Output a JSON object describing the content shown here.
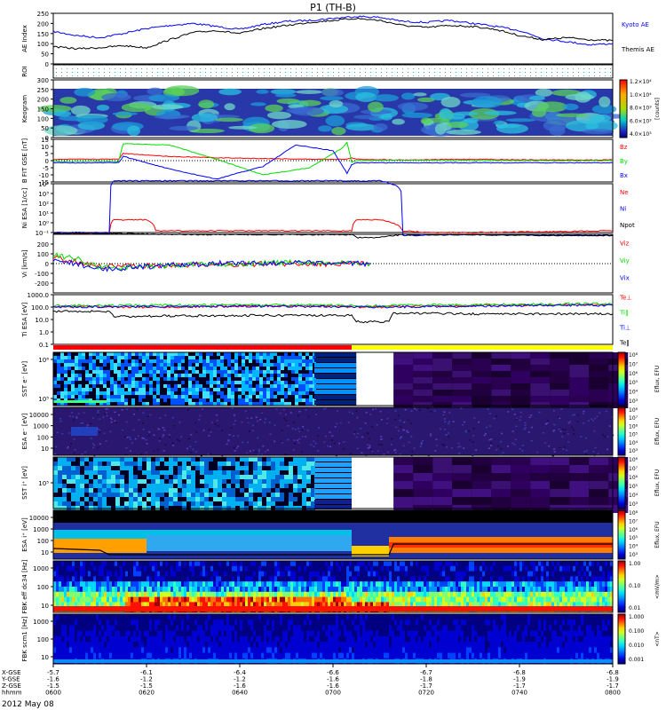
{
  "title": "P1 (TH-B)",
  "date_label": "2012 May 08",
  "colors": {
    "kyoto": "#0000ff",
    "themis": "#000000",
    "red": "#ff0000",
    "green": "#00dd00",
    "blue": "#0000ff",
    "black": "#000000",
    "bar_red": "#ff0000",
    "bar_yellow": "#ffff00"
  },
  "chart_data": [
    {
      "type": "line",
      "id": "ae",
      "ylabel": "AE Index",
      "ylim": [
        0,
        250
      ],
      "yticks": [
        "250",
        "200",
        "150",
        "100",
        "50",
        "0"
      ],
      "series": [
        {
          "name": "Kyoto AE",
          "x": [
            "06:00",
            "06:05",
            "06:10",
            "06:15",
            "06:20",
            "06:25",
            "06:30",
            "06:35",
            "06:40",
            "06:45",
            "06:50",
            "06:55",
            "07:00",
            "07:05",
            "07:10",
            "07:15",
            "07:20",
            "07:25",
            "07:30",
            "07:35",
            "07:40",
            "07:45",
            "07:50",
            "07:55",
            "08:00"
          ],
          "values": [
            160,
            140,
            130,
            150,
            175,
            190,
            200,
            185,
            170,
            195,
            210,
            215,
            225,
            235,
            230,
            210,
            205,
            215,
            200,
            185,
            165,
            125,
            110,
            95,
            100
          ]
        },
        {
          "name": "Themis AE",
          "x": [
            "06:00",
            "06:05",
            "06:10",
            "06:15",
            "06:20",
            "06:25",
            "06:30",
            "06:35",
            "06:40",
            "06:45",
            "06:50",
            "06:55",
            "07:00",
            "07:05",
            "07:10",
            "07:15",
            "07:20",
            "07:25",
            "07:30",
            "07:35",
            "07:40",
            "07:45",
            "07:50",
            "07:55",
            "08:00"
          ],
          "values": [
            85,
            75,
            80,
            90,
            80,
            120,
            155,
            165,
            150,
            175,
            190,
            205,
            215,
            225,
            215,
            190,
            180,
            190,
            185,
            170,
            140,
            120,
            130,
            120,
            115
          ]
        }
      ]
    },
    {
      "type": "heatmap",
      "id": "roi",
      "ylabel": "ROI"
    },
    {
      "type": "heatmap",
      "id": "keogram",
      "ylabel": "Keogram",
      "ylim": [
        0,
        300
      ],
      "yticks": [
        "300",
        "250",
        "200",
        "150",
        "100",
        "50",
        "0"
      ],
      "colorbar": {
        "label": "[counts]",
        "ticks": [
          "1.2×10⁴",
          "1.0×10⁴",
          "8.0×10³",
          "6.0×10³",
          "4.0×10³"
        ]
      }
    },
    {
      "type": "line",
      "id": "bfgm",
      "ylabel": "B FIT GSE [nT]",
      "ylim": [
        -15,
        15
      ],
      "yticks": [
        "15",
        "10",
        "5",
        "0",
        "-5",
        "-10",
        "-15"
      ],
      "series": [
        {
          "name": "Bz",
          "x": [
            "06:00",
            "06:14",
            "06:15",
            "06:25",
            "06:35",
            "06:45",
            "06:55",
            "07:03",
            "07:04",
            "07:05",
            "07:15",
            "07:30",
            "07:45",
            "08:00"
          ],
          "values": [
            1,
            1,
            5,
            3,
            2,
            1.5,
            1,
            1,
            2,
            1,
            0.5,
            1,
            0.5,
            0.5
          ]
        },
        {
          "name": "By",
          "x": [
            "06:00",
            "06:14",
            "06:15",
            "06:25",
            "06:35",
            "06:45",
            "06:55",
            "07:02",
            "07:03",
            "07:04",
            "07:05",
            "07:15",
            "07:30",
            "07:45",
            "08:00"
          ],
          "values": [
            -0.5,
            -0.5,
            12,
            11,
            1,
            -10,
            -5,
            9,
            13,
            -1,
            0,
            0.3,
            0,
            0,
            0
          ]
        },
        {
          "name": "Bx",
          "x": [
            "06:00",
            "06:14",
            "06:15",
            "06:25",
            "06:35",
            "06:45",
            "06:52",
            "07:00",
            "07:03",
            "07:04",
            "07:05",
            "07:15",
            "07:30",
            "07:45",
            "08:00"
          ],
          "values": [
            -1.5,
            -1.5,
            3,
            -6,
            -13,
            -4,
            11,
            7,
            -9,
            -3,
            -1.5,
            -1.5,
            -1.5,
            -1.5,
            -1.5
          ]
        }
      ]
    },
    {
      "type": "line",
      "id": "ni",
      "ylabel": "Ni ESA [1/cc]",
      "yticks": [
        "10⁴",
        "10³",
        "10²",
        "10¹",
        "10⁰",
        "10⁻¹"
      ],
      "series": [
        {
          "name": "Ne",
          "x": [
            "06:00",
            "06:12",
            "06:13",
            "06:20",
            "06:22",
            "06:40",
            "06:55",
            "07:04",
            "07:05",
            "07:10",
            "07:15",
            "07:20",
            "07:30",
            "07:45",
            "08:00"
          ],
          "values": [
            0.08,
            0.08,
            2,
            2,
            0.15,
            0.15,
            0.15,
            0.15,
            2,
            2,
            0.15,
            0.1,
            0.1,
            0.12,
            0.15
          ]
        },
        {
          "name": "Ni",
          "x": [
            "06:00",
            "06:12",
            "06:13",
            "06:30",
            "06:55",
            "07:04",
            "07:05",
            "07:10",
            "07:15",
            "07:30",
            "07:45",
            "08:00"
          ],
          "values": [
            0.1,
            0.1,
            20000,
            20000,
            20000,
            20000,
            20000,
            20000,
            0.05,
            0.06,
            0.05,
            0.05
          ]
        },
        {
          "name": "Npot",
          "x": [
            "06:00",
            "06:12",
            "06:13",
            "06:30",
            "06:55",
            "07:04",
            "07:05",
            "07:10",
            "07:15",
            "07:30",
            "07:45",
            "08:00"
          ],
          "values": [
            0.08,
            0.08,
            0.08,
            0.06,
            0.06,
            0.06,
            0.03,
            0.03,
            0.06,
            0.06,
            0.05,
            0.05
          ]
        }
      ]
    },
    {
      "type": "line",
      "id": "vi",
      "ylabel": "Vi [km/s]",
      "ylim": [
        -300,
        300
      ],
      "yticks": [
        "200",
        "100",
        "0",
        "-100",
        "-200"
      ],
      "series": [
        {
          "name": "Viz",
          "x": [
            "06:00",
            "06:05",
            "06:10",
            "06:20",
            "06:30",
            "06:40",
            "06:50",
            "07:00",
            "07:08"
          ],
          "values": [
            60,
            20,
            -30,
            -20,
            -10,
            -5,
            0,
            -5,
            0
          ]
        },
        {
          "name": "Viy",
          "x": [
            "06:00",
            "06:05",
            "06:10",
            "06:20",
            "06:30",
            "06:40",
            "06:50",
            "07:00",
            "07:08"
          ],
          "values": [
            90,
            50,
            -40,
            -30,
            -10,
            0,
            10,
            5,
            0
          ]
        },
        {
          "name": "Vix",
          "x": [
            "06:00",
            "06:05",
            "06:10",
            "06:20",
            "06:30",
            "06:40",
            "06:50",
            "07:00",
            "07:08"
          ],
          "values": [
            30,
            0,
            -60,
            -30,
            -10,
            10,
            5,
            0,
            0
          ]
        }
      ]
    },
    {
      "type": "line",
      "id": "ti",
      "ylabel": "Ti ESA [eV]",
      "yticks": [
        "1000.0",
        "100.0",
        "10.0",
        "1.0",
        "0.1"
      ],
      "series": [
        {
          "name": "Te⊥",
          "x": [
            "06:00",
            "06:10",
            "06:20",
            "06:40",
            "07:00",
            "07:05",
            "07:10",
            "07:20",
            "07:40",
            "08:00"
          ],
          "values": [
            120,
            110,
            100,
            120,
            120,
            100,
            100,
            120,
            150,
            180
          ]
        },
        {
          "name": "Ti‖",
          "x": [
            "06:00",
            "06:10",
            "06:20",
            "06:40",
            "07:00",
            "07:05",
            "07:10",
            "07:20",
            "07:40",
            "08:00"
          ],
          "values": [
            130,
            140,
            150,
            160,
            150,
            130,
            130,
            160,
            170,
            200
          ]
        },
        {
          "name": "Ti⊥",
          "x": [
            "06:00",
            "06:10",
            "06:20",
            "06:40",
            "07:00",
            "07:05",
            "07:10",
            "07:20",
            "07:40",
            "08:00"
          ],
          "values": [
            100,
            110,
            110,
            120,
            110,
            100,
            100,
            110,
            130,
            150
          ]
        },
        {
          "name": "Te‖",
          "x": [
            "06:00",
            "06:12",
            "06:13",
            "06:40",
            "07:04",
            "07:05",
            "07:12",
            "07:13",
            "07:30",
            "08:00"
          ],
          "values": [
            40,
            40,
            15,
            18,
            18,
            5,
            5,
            30,
            25,
            25
          ]
        }
      ]
    },
    {
      "type": "heatmap",
      "id": "sst_e",
      "ylabel": "SST e⁻ [eV]",
      "yticks": [
        "10⁶",
        "10⁵"
      ]
    },
    {
      "type": "heatmap",
      "id": "esa_e",
      "ylabel": "ESA e⁻ [eV]",
      "yticks": [
        "10000",
        "1000",
        "100",
        "10"
      ]
    },
    {
      "type": "heatmap",
      "id": "sst_i",
      "ylabel": "SST i⁺ [eV]",
      "yticks": [
        "10⁵"
      ]
    },
    {
      "type": "heatmap",
      "id": "esa_i",
      "ylabel": "ESA i⁺ [eV]",
      "yticks": [
        "10000",
        "1000",
        "100",
        "10"
      ]
    },
    {
      "type": "heatmap",
      "id": "fbk_e",
      "ylabel": "FBK eff dc34 [Hz]",
      "yticks": [
        "1000",
        "100",
        "10"
      ]
    },
    {
      "type": "heatmap",
      "id": "fbk_b",
      "ylabel": "FBK scm1 [Hz]",
      "yticks": [
        "1000",
        "100",
        "10"
      ]
    }
  ],
  "colorbars": {
    "eflux_ticks": [
      "10⁸",
      "10⁷",
      "10⁶",
      "10⁵",
      "10⁴",
      "10³"
    ],
    "eflux_label": "Eflux, EFU",
    "fbk_e_ticks": [
      "1.00",
      "0.10",
      "0.01"
    ],
    "fbk_e_label": "<mV/m>",
    "fbk_b_ticks": [
      "1.000",
      "0.100",
      "0.010",
      "0.001"
    ],
    "fbk_b_label": "<nT>"
  },
  "x_axis": {
    "times": [
      "0600",
      "0620",
      "0640",
      "0700",
      "0720",
      "0740",
      "0800"
    ],
    "x_gse": [
      "-5.7",
      "-6.1",
      "-6.4",
      "-6.6",
      "-6.7",
      "-6.8",
      "-6.8"
    ],
    "y_gse": [
      "-1.6",
      "-1.2",
      "-1.2",
      "-1.6",
      "-1.8",
      "-1.9",
      "-1.9"
    ],
    "z_gse": [
      "-1.5",
      "-1.5",
      "-1.6",
      "-1.6",
      "-1.7",
      "-1.7",
      "-1.7"
    ],
    "row_labels": [
      "X-GSE",
      "Y-GSE",
      "Z-GSE",
      "hhmm"
    ]
  }
}
